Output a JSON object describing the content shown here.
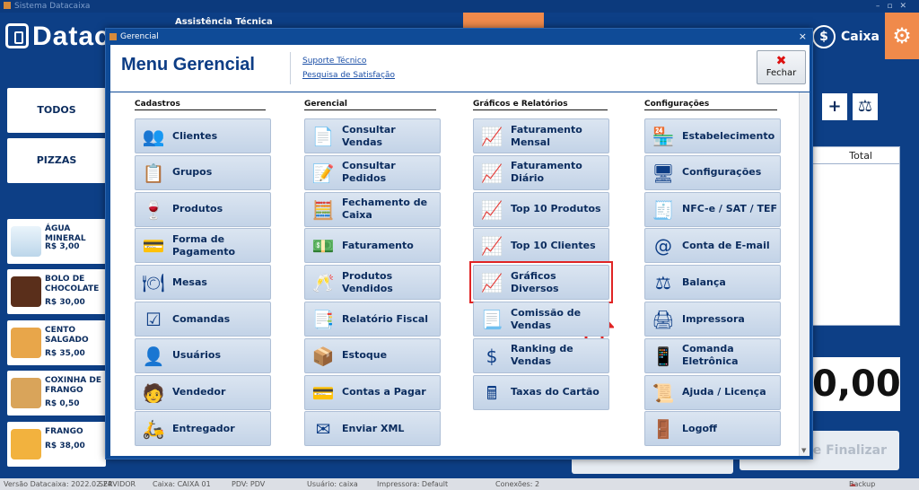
{
  "app": {
    "title": "Sistema Datacaixa",
    "logo_text": "Datac",
    "assist": "Assistência Técnica",
    "caixa_label": "Caixa",
    "caixa_icon": "dollar-circle-icon",
    "settings_icon": "gears-icon"
  },
  "categories": [
    "TODOS",
    "PIZZAS"
  ],
  "products": [
    {
      "name": "ÁGUA MINERAL",
      "price": "R$ 3,00"
    },
    {
      "name": "BOLO DE CHOCOLATE",
      "price": "R$ 30,00"
    },
    {
      "name": "CENTO SALGADO",
      "price": "R$ 35,00"
    },
    {
      "name": "COXINHA DE FRANGO",
      "price": "R$ 0,50"
    },
    {
      "name": "FRANGO",
      "price": "R$ 38,00"
    }
  ],
  "cart": {
    "col_total": "Total",
    "total_value": "0,00",
    "finalize_label": "er e Finalizar"
  },
  "statusbar": {
    "version": "Versão Datacaixa: 2022.02.24",
    "server": "SERVIDOR",
    "caixa": "Caixa: CAIXA 01",
    "pdv": "PDV: PDV",
    "user": "Usuário: caixa",
    "printer": "Impressora: Default",
    "connections": "Conexões: 2",
    "backup": "Backup Nuvem"
  },
  "modal": {
    "window_title": "Gerencial",
    "title": "Menu Gerencial",
    "link_support": "Suporte Técnico",
    "link_survey": "Pesquisa de Satisfação",
    "close_label": "Fechar",
    "close_window": "×",
    "columns": [
      {
        "header": "Cadastros",
        "items": [
          {
            "label": "Clientes",
            "icon": "users-icon"
          },
          {
            "label": "Grupos",
            "icon": "clipboard-list-icon"
          },
          {
            "label": "Produtos",
            "icon": "wine-bottle-icon"
          },
          {
            "label": "Forma de Pagamento",
            "icon": "payment-card-icon"
          },
          {
            "label": "Mesas",
            "icon": "table-dining-icon"
          },
          {
            "label": "Comandas",
            "icon": "checklist-icon"
          },
          {
            "label": "Usuários",
            "icon": "user-group-icon"
          },
          {
            "label": "Vendedor",
            "icon": "seller-icon"
          },
          {
            "label": "Entregador",
            "icon": "delivery-person-icon"
          }
        ]
      },
      {
        "header": "Gerencial",
        "items": [
          {
            "label": "Consultar Vendas",
            "icon": "document-icon"
          },
          {
            "label": "Consultar Pedidos",
            "icon": "edit-document-icon"
          },
          {
            "label": "Fechamento de Caixa",
            "icon": "calculator-cash-icon"
          },
          {
            "label": "Faturamento",
            "icon": "money-bill-icon"
          },
          {
            "label": "Produtos Vendidos",
            "icon": "wine-glasses-icon"
          },
          {
            "label": "Relatório Fiscal",
            "icon": "fiscal-report-icon"
          },
          {
            "label": "Estoque",
            "icon": "boxes-icon"
          },
          {
            "label": "Contas a Pagar",
            "icon": "credit-cards-icon"
          },
          {
            "label": "Enviar XML",
            "icon": "envelope-icon"
          }
        ]
      },
      {
        "header": "Gráficos e Relatórios",
        "items": [
          {
            "label": "Faturamento Mensal",
            "icon": "chart-report-icon"
          },
          {
            "label": "Faturamento Diário",
            "icon": "chart-report-icon"
          },
          {
            "label": "Top 10 Produtos",
            "icon": "chart-report-icon"
          },
          {
            "label": "Top 10 Clientes",
            "icon": "chart-report-icon"
          },
          {
            "label": "Gráficos Diversos",
            "icon": "chart-report-icon"
          },
          {
            "label": "Comissão de Vendas",
            "icon": "commission-icon"
          },
          {
            "label": "Ranking de Vendas",
            "icon": "dollar-coin-icon"
          },
          {
            "label": "Taxas do Cartão",
            "icon": "calculator-icon"
          }
        ]
      },
      {
        "header": "Configurações",
        "items": [
          {
            "label": "Estabelecimento",
            "icon": "store-icon"
          },
          {
            "label": "Configurações",
            "icon": "settings-devices-icon"
          },
          {
            "label": "NFC-e / SAT / TEF",
            "icon": "receipt-icon"
          },
          {
            "label": "Conta de E-mail",
            "icon": "at-sign-icon"
          },
          {
            "label": "Balança",
            "icon": "scale-icon"
          },
          {
            "label": "Impressora",
            "icon": "printer-icon"
          },
          {
            "label": "Comanda Eletrônica",
            "icon": "mobile-device-icon"
          },
          {
            "label": "Ajuda / Licença",
            "icon": "certificate-icon"
          },
          {
            "label": "Logoff",
            "icon": "exit-door-icon"
          }
        ]
      }
    ],
    "highlighted_item": "Gráficos Diversos",
    "highlight_color": "#e02424"
  }
}
